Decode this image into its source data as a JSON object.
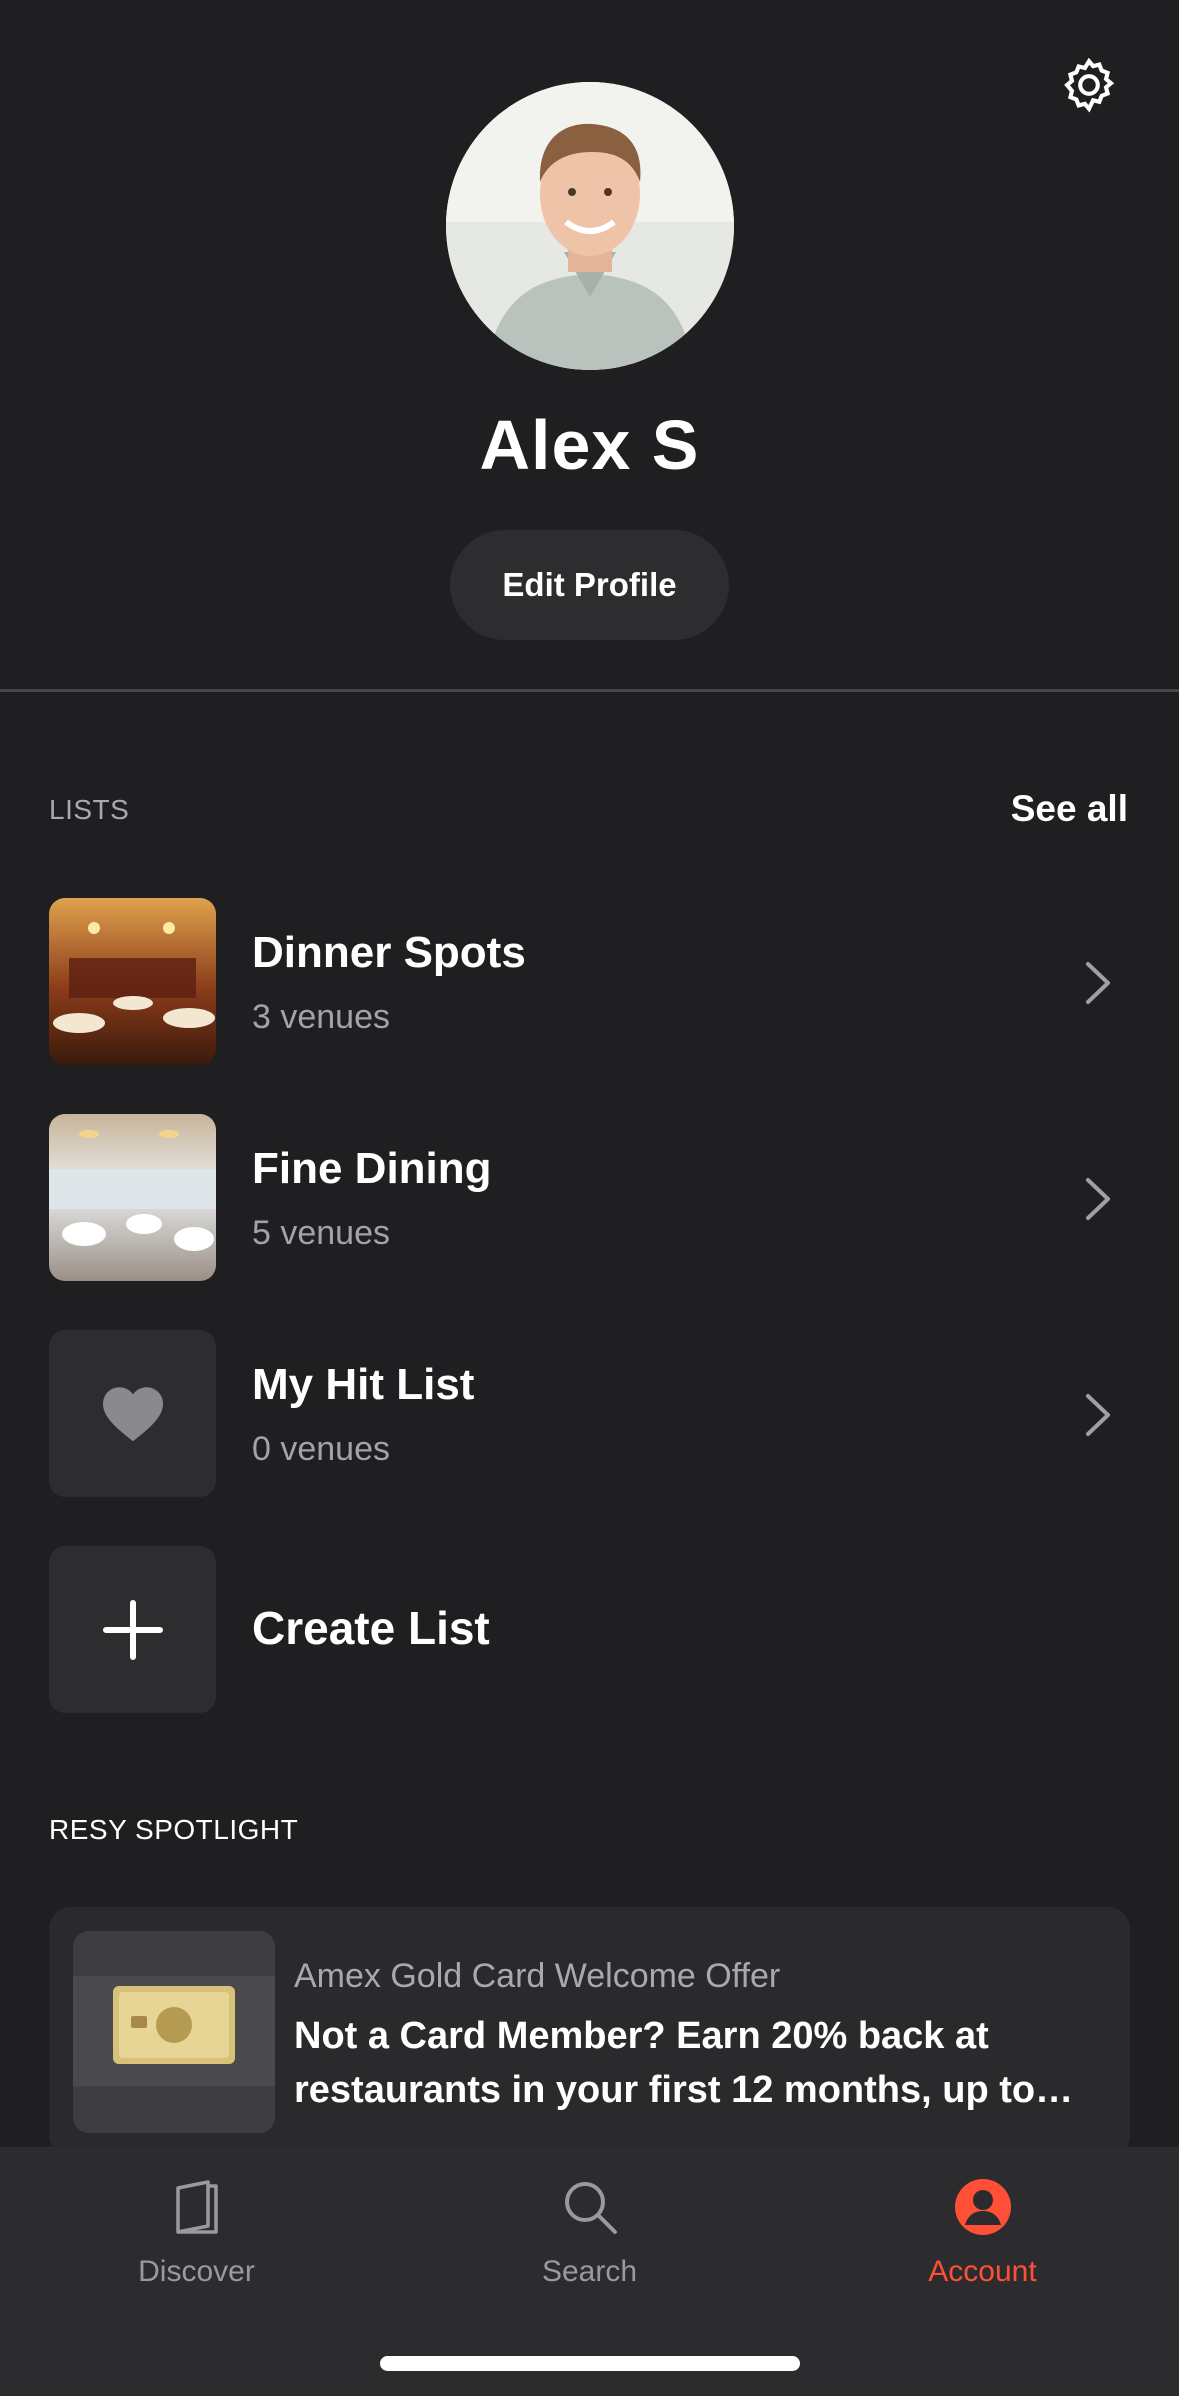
{
  "header": {
    "settings_icon": "gear-icon"
  },
  "profile": {
    "name": "Alex S",
    "edit_label": "Edit Profile"
  },
  "lists": {
    "section_label": "LISTS",
    "see_all_label": "See all",
    "items": [
      {
        "title": "Dinner Spots",
        "count": "3 venues",
        "thumb": "restaurant-photo"
      },
      {
        "title": "Fine Dining",
        "count": "5 venues",
        "thumb": "restaurant-photo"
      },
      {
        "title": "My Hit List",
        "count": "0 venues",
        "thumb": "heart-icon"
      }
    ],
    "create_label": "Create List"
  },
  "spotlight": {
    "section_label": "RESY SPOTLIGHT",
    "card": {
      "subtitle": "Amex Gold Card Welcome Offer",
      "text": "Not a Card Member? Earn 20% back at restaurants in your first 12 months, up to…"
    }
  },
  "tabbar": {
    "tabs": [
      {
        "label": "Discover",
        "icon": "book-icon"
      },
      {
        "label": "Search",
        "icon": "search-icon"
      },
      {
        "label": "Account",
        "icon": "account-icon",
        "active": true
      }
    ]
  },
  "colors": {
    "background": "#1f1f21",
    "accent": "#ff4f37",
    "card": "#2d2d30"
  }
}
